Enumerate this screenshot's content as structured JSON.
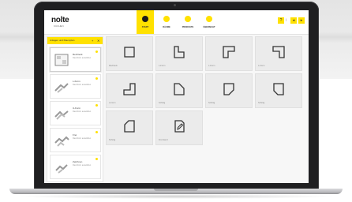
{
  "app": {
    "logo": "nolte",
    "logo_sub": "KÜCHEN",
    "nav": [
      {
        "label": "START",
        "active": true
      },
      {
        "label": "RÄUME",
        "active": false
      },
      {
        "label": "PRODUKTE",
        "active": false
      },
      {
        "label": "ÜBERSICHT",
        "active": false
      }
    ],
    "header_buttons": [
      "?",
      "i",
      "◂",
      "▸"
    ]
  },
  "sidebar": {
    "title": "Anlagen und Raumplan",
    "actions": [
      "+",
      "✕"
    ],
    "items": [
      {
        "name": "Rechteck",
        "desc": "Raumform auswählen",
        "icon": "room-plan-icon",
        "selected": true
      },
      {
        "name": "L-Form",
        "desc": "Raumform auswählen",
        "icon": "walls-icon",
        "selected": false
      },
      {
        "name": "U-Form",
        "desc": "Raumform auswählen",
        "icon": "walls-icon",
        "selected": false
      },
      {
        "name": "Frei",
        "desc": "Raumform auswählen",
        "icon": "walls-icon",
        "selected": false
      },
      {
        "name": "Zeichnen",
        "desc": "Raumform auswählen",
        "icon": "walls-icon",
        "selected": false
      }
    ]
  },
  "tiles": [
    {
      "label": "Rechteck",
      "icon": "rectangle-room-icon"
    },
    {
      "label": "L-Form",
      "icon": "l-shape-room-icon"
    },
    {
      "label": "L-Form",
      "icon": "l-shape-room-icon"
    },
    {
      "label": "L-Form",
      "icon": "l-shape-room-icon"
    },
    {
      "label": "L-Form",
      "icon": "l-shape-room-icon"
    },
    {
      "label": "Schräg",
      "icon": "angled-room-icon"
    },
    {
      "label": "Schräg",
      "icon": "angled-room-icon"
    },
    {
      "label": "Schräg",
      "icon": "angled-room-icon"
    },
    {
      "label": "Schräg",
      "icon": "angled-room-icon"
    },
    {
      "label": "Frei Hand",
      "icon": "freehand-draw-icon"
    }
  ],
  "colors": {
    "accent": "#ffe100",
    "tile": "#ebebeb"
  }
}
